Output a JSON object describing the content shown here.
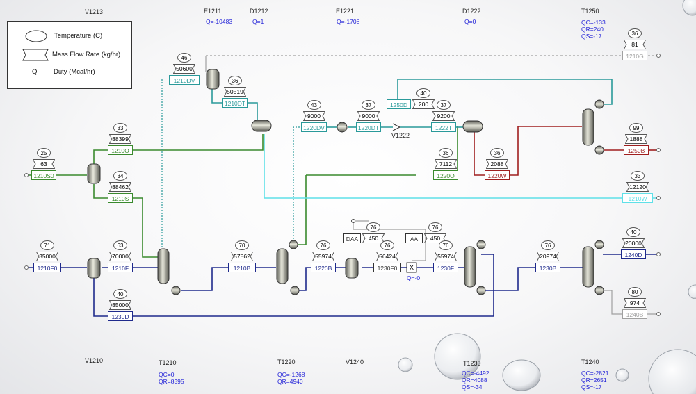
{
  "legend": {
    "temperature": "Temperature (C)",
    "mass_flow": "Mass Flow Rate (kg/hr)",
    "duty_symbol": "Q",
    "duty": "Duty (Mcal/hr)"
  },
  "header_labels": {
    "v1213": "V1213",
    "e1211": "E1211",
    "e1211_q": "Q=-10483",
    "d1212": "D1212",
    "d1212_q": "Q=1",
    "e1221": "E1221",
    "e1221_q": "Q=-1708",
    "d1222": "D1222",
    "d1222_q": "Q=0",
    "t1250": "T1250",
    "t1250_qc": "QC=-133",
    "t1250_qr": "QR=240",
    "t1250_qs": "QS=-17"
  },
  "footer_labels": {
    "v1210": "V1210",
    "t1210": "T1210",
    "t1210_qc": "QC=0",
    "t1210_qr": "QR=8395",
    "t1220": "T1220",
    "t1220_qc": "QC=-1268",
    "t1220_qr": "QR=4940",
    "v1240": "V1240",
    "t1230": "T1230",
    "t1230_qc": "QC=-4492",
    "t1230_qr": "QR=4088",
    "t1230_qs": "QS=-34",
    "t1240": "T1240",
    "t1240_qc": "QC=-2821",
    "t1240_qr": "QR=2651",
    "t1240_qs": "QS=-17"
  },
  "mixer_label": "V1222",
  "mixer_q": "Q=-0",
  "colors": {
    "green": "#3a8a2e",
    "teal": "#2a9a9a",
    "red": "#a01f1f",
    "navy": "#1f2a8c",
    "cyan": "#5fe0e8",
    "gray": "#a0a0a0"
  },
  "streams": {
    "s1210S0": {
      "tag": "1210S0",
      "temp": "25",
      "flow": "63"
    },
    "s1210O": {
      "tag": "1210O",
      "temp": "33",
      "flow": "38399"
    },
    "s1210S": {
      "tag": "1210S",
      "temp": "34",
      "flow": "38462"
    },
    "s1210DV": {
      "tag": "1210DV",
      "temp": "46",
      "flow": "50600"
    },
    "s1210DT": {
      "tag": "1210DT",
      "temp": "36",
      "flow": "50519"
    },
    "s1220DV": {
      "tag": "1220DV",
      "temp": "43",
      "flow": "9000"
    },
    "s1220DT": {
      "tag": "1220DT",
      "temp": "37",
      "flow": "9000"
    },
    "s1250D": {
      "tag": "1250D",
      "temp": "40",
      "flow": "200"
    },
    "s1222T": {
      "tag": "1222T",
      "temp": "37",
      "flow": "9200"
    },
    "s1220O": {
      "tag": "1220O",
      "temp": "36",
      "flow": "7112"
    },
    "s1220W": {
      "tag": "1220W",
      "temp": "36",
      "flow": "2088"
    },
    "s1210G": {
      "tag": "1210G",
      "temp": "36",
      "flow": "81"
    },
    "s1250B": {
      "tag": "1250B",
      "temp": "99",
      "flow": "1888"
    },
    "s1210W": {
      "tag": "1210W",
      "temp": "33",
      "flow": "12120"
    },
    "s1210F0": {
      "tag": "1210F0",
      "temp": "71",
      "flow": "35000"
    },
    "s1210F": {
      "tag": "1210F",
      "temp": "63",
      "flow": "70000"
    },
    "s1230D": {
      "tag": "1230D",
      "temp": "40",
      "flow": "35000"
    },
    "s1210B": {
      "tag": "1210B",
      "temp": "70",
      "flow": "57862"
    },
    "s1220B": {
      "tag": "1220B",
      "temp": "76",
      "flow": "55974"
    },
    "sDAA": {
      "tag": "DAA",
      "temp": "76",
      "flow": "450"
    },
    "s1230F0": {
      "tag": "1230F0",
      "temp": "76",
      "flow": "56424"
    },
    "sAA": {
      "tag": "AA",
      "temp": "76",
      "flow": "450"
    },
    "s1230F": {
      "tag": "1230F",
      "temp": "76",
      "flow": "55974"
    },
    "s1230B": {
      "tag": "1230B",
      "temp": "76",
      "flow": "20974"
    },
    "s1240D": {
      "tag": "1240D",
      "temp": "40",
      "flow": "20000"
    },
    "s1240B": {
      "tag": "1240B",
      "temp": "80",
      "flow": "974"
    }
  }
}
